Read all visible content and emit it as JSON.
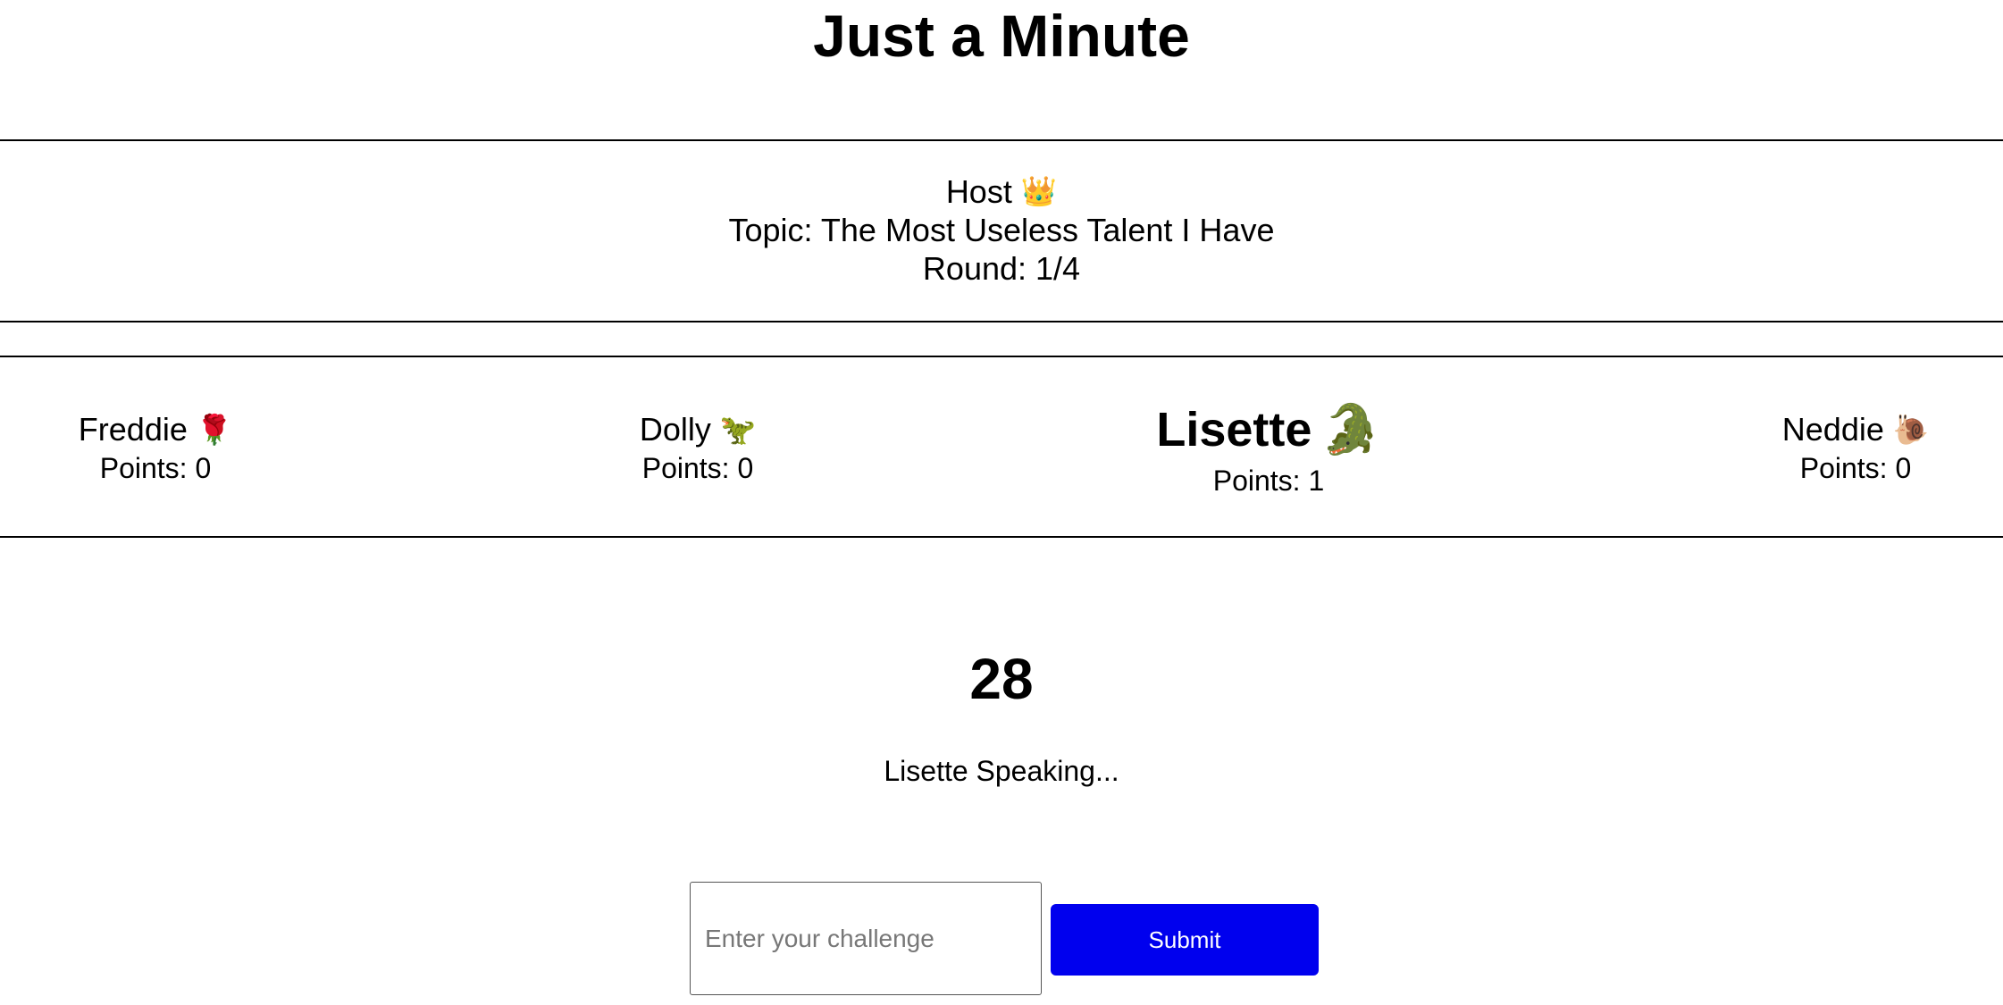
{
  "app": {
    "title": "Just a Minute"
  },
  "host": {
    "label": "Host",
    "icon": "👑",
    "topic": "Topic: The Most Useless Talent I Have",
    "round": "Round: 1/4"
  },
  "players": [
    {
      "name": "Freddie",
      "icon": "🌹",
      "points": "Points: 0",
      "active": false
    },
    {
      "name": "Dolly",
      "icon": "🦖",
      "points": "Points: 0",
      "active": false
    },
    {
      "name": "Lisette",
      "icon": "🐊",
      "points": "Points: 1",
      "active": true
    },
    {
      "name": "Neddie",
      "icon": "🐌",
      "points": "Points: 0",
      "active": false
    }
  ],
  "game": {
    "timer": "28",
    "status": "Lisette Speaking..."
  },
  "challenge": {
    "placeholder": "Enter your challenge",
    "value": "",
    "submit_label": "Submit"
  },
  "colors": {
    "submit_button": "#0000ee",
    "rule": "#000000"
  }
}
